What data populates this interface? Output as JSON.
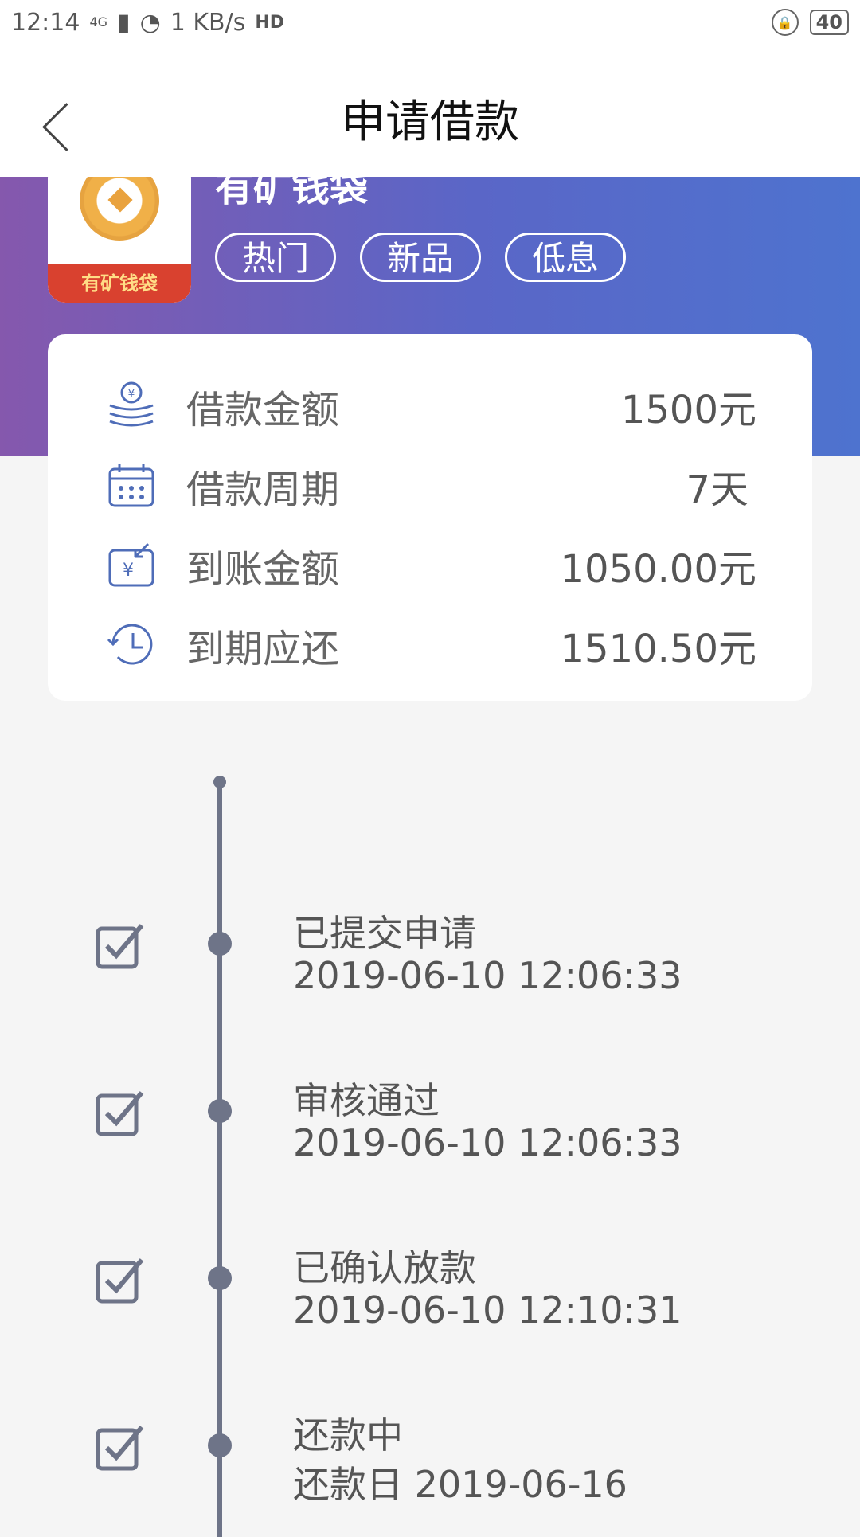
{
  "status_bar": {
    "time": "12:14",
    "network": "4G",
    "speed": "1 KB/s",
    "hd": "HD",
    "battery": "40"
  },
  "header": {
    "title": "申请借款"
  },
  "app": {
    "name": "有矿钱袋",
    "logo_text": "有矿钱袋",
    "tags": [
      "热门",
      "新品",
      "低息"
    ]
  },
  "loan": {
    "rows": [
      {
        "label": "借款金额",
        "value": "1500元",
        "icon": "coins-icon"
      },
      {
        "label": "借款周期",
        "value": "7天",
        "icon": "calendar-icon"
      },
      {
        "label": "到账金额",
        "value": "1050.00元",
        "icon": "money-in-icon"
      },
      {
        "label": "到期应还",
        "value": "1510.50元",
        "icon": "history-clock-icon"
      }
    ]
  },
  "timeline": {
    "steps": [
      {
        "title": "已提交申请",
        "time": "2019-06-10 12:06:33"
      },
      {
        "title": "审核通过",
        "time": "2019-06-10 12:06:33"
      },
      {
        "title": "已确认放款",
        "time": "2019-06-10 12:10:31"
      },
      {
        "title": "还款中",
        "time": "还款日 2019-06-16"
      }
    ]
  },
  "colors": {
    "accent_start": "#8558ad",
    "accent_end": "#4e73cf",
    "timeline": "#6e7488"
  }
}
